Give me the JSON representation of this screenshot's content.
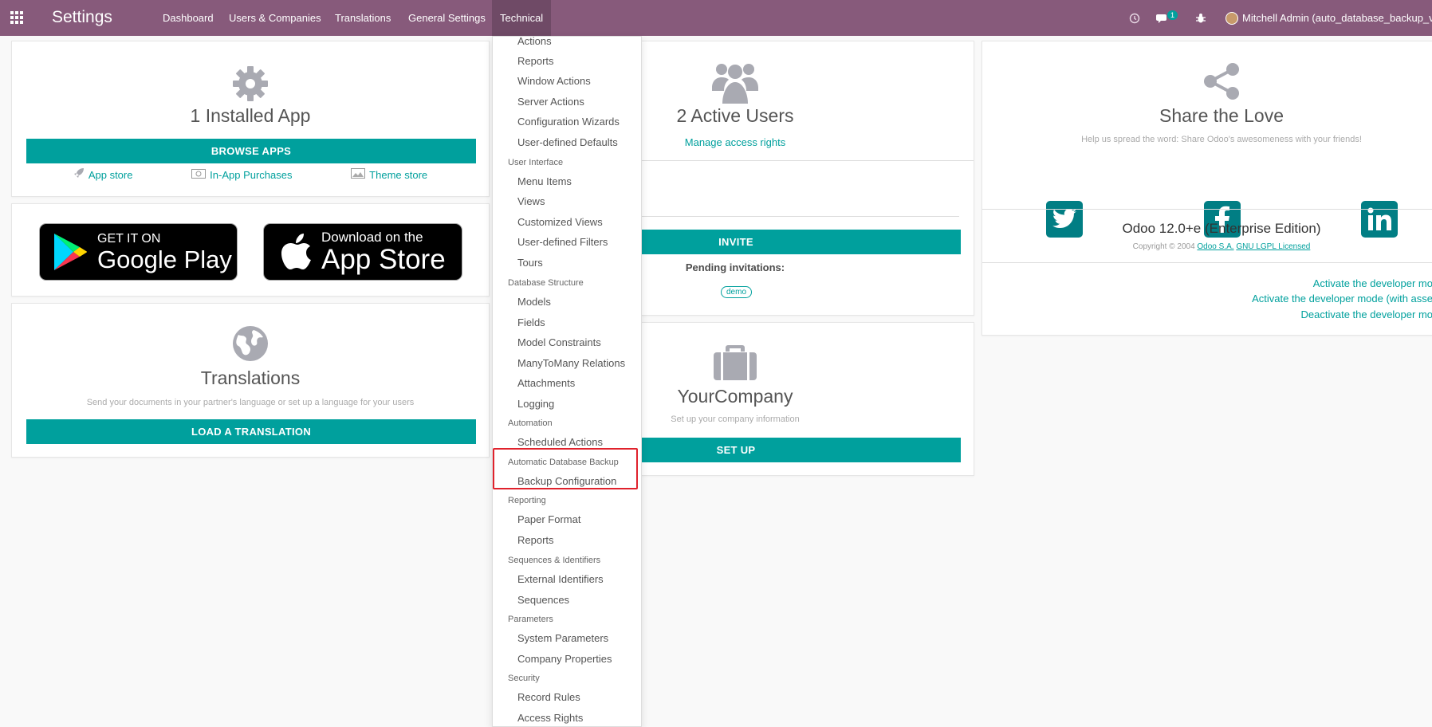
{
  "navbar": {
    "brand": "Settings",
    "menus": [
      "Dashboard",
      "Users & Companies",
      "Translations",
      "General Settings",
      "Technical"
    ],
    "active_menu": "Technical",
    "chat_badge": "1",
    "user": "Mitchell Admin (auto_database_backup_v",
    "icons": [
      "apps-grid-icon",
      "clock-icon",
      "chat-icon",
      "bug-icon"
    ]
  },
  "apps_card": {
    "title": "1 Installed App",
    "browse_button": "BROWSE APPS",
    "links": [
      {
        "label": "App store",
        "icon": "rocket-icon"
      },
      {
        "label": "In-App Purchases",
        "icon": "money-icon"
      },
      {
        "label": "Theme store",
        "icon": "image-icon"
      }
    ]
  },
  "store_badges": {
    "google": {
      "small": "GET IT ON",
      "big": "Google Play"
    },
    "apple": {
      "small": "Download on the",
      "big": "App Store"
    }
  },
  "translations_card": {
    "title": "Translations",
    "subtitle": "Send your documents in your partner's language or set up a language for your users",
    "button": "LOAD A TRANSLATION"
  },
  "users_card": {
    "title": "2 Active Users",
    "manage_link": "Manage access rights",
    "invite_button": "INVITE",
    "pending_label": "Pending invitations:",
    "pending": [
      "demo"
    ]
  },
  "company_card": {
    "title": "YourCompany",
    "subtitle": "Set up your company information",
    "button": "SET UP"
  },
  "share_card": {
    "title": "Share the Love",
    "subtitle": "Help us spread the word: Share Odoo's awesomeness with your friends!",
    "socials": [
      "twitter-icon",
      "facebook-icon",
      "linkedin-icon"
    ],
    "version": "Odoo 12.0+e (Enterprise Edition)",
    "copyright_prefix": "Copyright © 2004",
    "copyright_company": "Odoo S.A.",
    "license": "GNU LGPL Licensed",
    "dev_links": [
      "Activate the developer mo",
      "Activate the developer mode (with asse",
      "Deactivate the developer mo"
    ]
  },
  "technical_menu": [
    {
      "type": "item",
      "label": "Actions"
    },
    {
      "type": "item",
      "label": "Reports"
    },
    {
      "type": "item",
      "label": "Window Actions"
    },
    {
      "type": "item",
      "label": "Server Actions"
    },
    {
      "type": "item",
      "label": "Configuration Wizards"
    },
    {
      "type": "item",
      "label": "User-defined Defaults"
    },
    {
      "type": "header",
      "label": "User Interface"
    },
    {
      "type": "item",
      "label": "Menu Items"
    },
    {
      "type": "item",
      "label": "Views"
    },
    {
      "type": "item",
      "label": "Customized Views"
    },
    {
      "type": "item",
      "label": "User-defined Filters"
    },
    {
      "type": "item",
      "label": "Tours"
    },
    {
      "type": "header",
      "label": "Database Structure"
    },
    {
      "type": "item",
      "label": "Models"
    },
    {
      "type": "item",
      "label": "Fields"
    },
    {
      "type": "item",
      "label": "Model Constraints"
    },
    {
      "type": "item",
      "label": "ManyToMany Relations"
    },
    {
      "type": "item",
      "label": "Attachments"
    },
    {
      "type": "item",
      "label": "Logging"
    },
    {
      "type": "header",
      "label": "Automation"
    },
    {
      "type": "item",
      "label": "Scheduled Actions"
    },
    {
      "type": "header",
      "label": "Automatic Database Backup"
    },
    {
      "type": "item",
      "label": "Backup Configuration"
    },
    {
      "type": "header",
      "label": "Reporting"
    },
    {
      "type": "item",
      "label": "Paper Format"
    },
    {
      "type": "item",
      "label": "Reports"
    },
    {
      "type": "header",
      "label": "Sequences & Identifiers"
    },
    {
      "type": "item",
      "label": "External Identifiers"
    },
    {
      "type": "item",
      "label": "Sequences"
    },
    {
      "type": "header",
      "label": "Parameters"
    },
    {
      "type": "item",
      "label": "System Parameters"
    },
    {
      "type": "item",
      "label": "Company Properties"
    },
    {
      "type": "header",
      "label": "Security"
    },
    {
      "type": "item",
      "label": "Record Rules"
    },
    {
      "type": "item",
      "label": "Access Rights"
    }
  ],
  "colors": {
    "brand": "#875a7b",
    "accent": "#00a09d",
    "highlight": "#e0222c"
  }
}
